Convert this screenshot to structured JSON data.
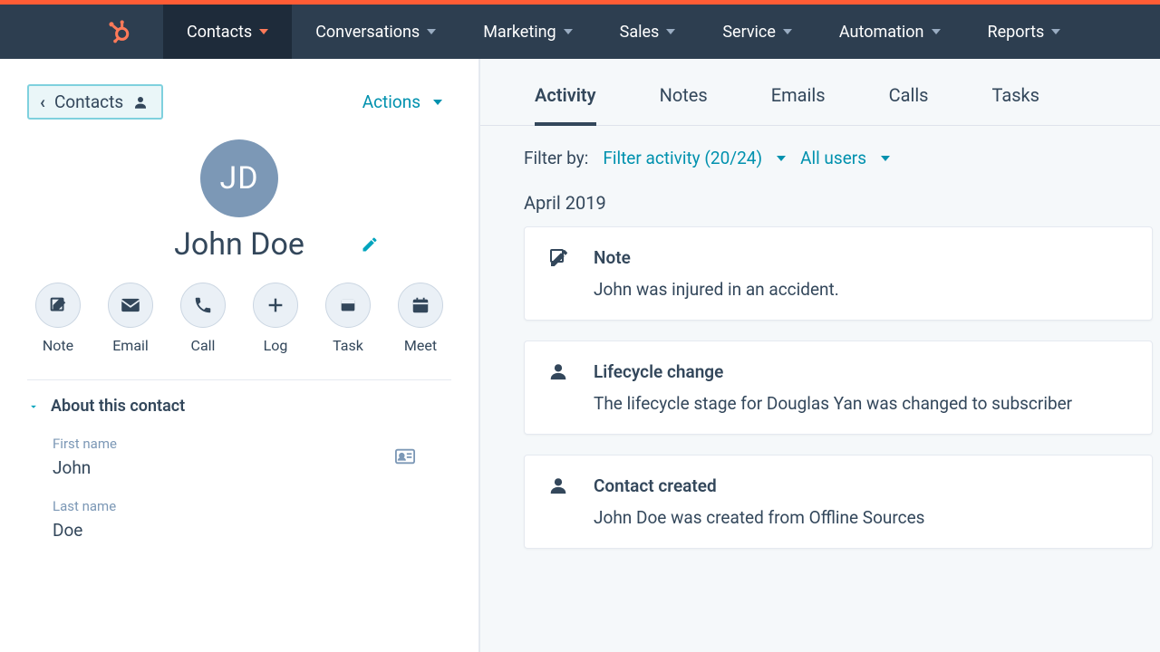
{
  "nav": {
    "items": [
      "Contacts",
      "Conversations",
      "Marketing",
      "Sales",
      "Service",
      "Automation",
      "Reports"
    ],
    "active_index": 0
  },
  "left": {
    "breadcrumb_label": "Contacts",
    "actions_label": "Actions",
    "avatar_initials": "JD",
    "contact_name": "John Doe",
    "action_buttons": [
      {
        "label": "Note",
        "icon": "compose-icon"
      },
      {
        "label": "Email",
        "icon": "envelope-icon"
      },
      {
        "label": "Call",
        "icon": "phone-icon"
      },
      {
        "label": "Log",
        "icon": "plus-icon"
      },
      {
        "label": "Task",
        "icon": "task-icon"
      },
      {
        "label": "Meet",
        "icon": "calendar-icon"
      }
    ],
    "about_section_title": "About this contact",
    "fields": {
      "first_name_label": "First name",
      "first_name_value": "John",
      "last_name_label": "Last name",
      "last_name_value": "Doe"
    }
  },
  "right": {
    "tabs": [
      "Activity",
      "Notes",
      "Emails",
      "Calls",
      "Tasks"
    ],
    "active_tab_index": 0,
    "filter_by_label": "Filter by:",
    "filter_activity_label": "Filter activity (20/24)",
    "filter_users_label": "All users",
    "month_heading": "April 2019",
    "timeline": [
      {
        "icon": "compose-icon",
        "title": "Note",
        "body": "John was injured in an accident."
      },
      {
        "icon": "person-icon",
        "title": "Lifecycle change",
        "body": "The lifecycle stage for Douglas Yan was changed to subscriber"
      },
      {
        "icon": "person-icon",
        "title": "Contact created",
        "body": "John Doe was created from Offline Sources"
      }
    ]
  }
}
